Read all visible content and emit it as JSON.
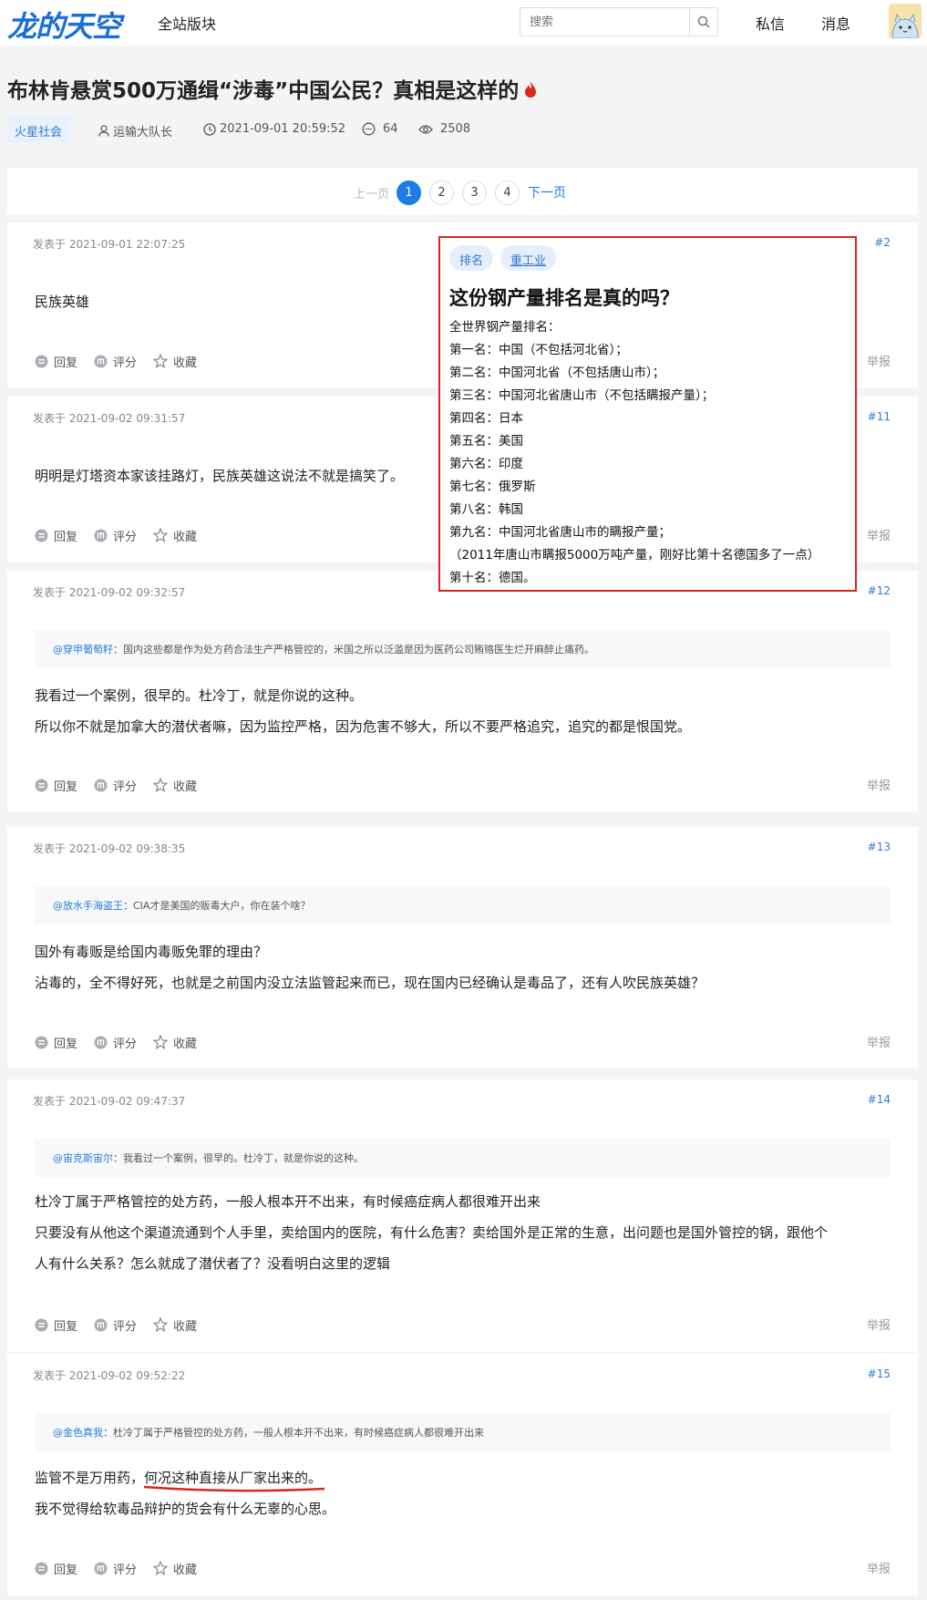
{
  "header": {
    "logo": "龙的天空",
    "nav_all": "全站版块",
    "search_placeholder": "搜索",
    "nav_dm": "私信",
    "nav_msg": "消息"
  },
  "thread": {
    "title": "布林肯悬赏500万通缉“涉毒”中国公民？真相是这样的",
    "category": "火星社会",
    "author": "运输大队长",
    "datetime": "2021-09-01 20:59:52",
    "replies": "64",
    "views": "2508"
  },
  "pager": {
    "prev": "上一页",
    "pages": [
      "1",
      "2",
      "3",
      "4"
    ],
    "current": "1",
    "next": "下一页"
  },
  "action_labels": {
    "reply": "回复",
    "rate": "评分",
    "fav": "收藏",
    "report": "举报"
  },
  "posts": [
    {
      "date": "发表于 2021-09-01 22:07:25",
      "floor": "#2",
      "quote": null,
      "lines": [
        "民族英雄"
      ]
    },
    {
      "date": "发表于 2021-09-02 09:31:57",
      "floor": "#11",
      "quote": null,
      "lines": [
        "明明是灯塔资本家该挂路灯，民族英雄这说法不就是搞笑了。"
      ]
    },
    {
      "date": "发表于 2021-09-02 09:32:57",
      "floor": "#12",
      "quote": {
        "name": "@穿甲葡萄籽",
        "text": "：国内这些都是作为处方药合法生产严格管控的，米国之所以泛滥是因为医药公司贿赂医生烂开麻醉止痛药。"
      },
      "lines": [
        "我看过一个案例，很早的。杜冷丁，就是你说的这种。",
        "所以你不就是加拿大的潜伏者嘛，因为监控严格，因为危害不够大，所以不要严格追究，追究的都是恨国党。"
      ]
    },
    {
      "date": "发表于 2021-09-02 09:38:35",
      "floor": "#13",
      "quote": {
        "name": "@放水手海盗王",
        "text": "：CIA才是美国的贩毒大户，你在装个啥？"
      },
      "lines": [
        "国外有毒贩是给国内毒贩免罪的理由？",
        "沾毒的，全不得好死，也就是之前国内没立法监管起来而已，现在国内已经确认是毒品了，还有人吹民族英雄？"
      ]
    },
    {
      "date": "发表于 2021-09-02 09:47:37",
      "floor": "#14",
      "quote": {
        "name": "@宙克斯宙尔",
        "text": "：我看过一个案例，很早的。杜冷丁，就是你说的这种。"
      },
      "lines": [
        "杜冷丁属于严格管控的处方药，一般人根本开不出来，有时候癌症病人都很难开出来",
        "只要没有从他这个渠道流通到个人手里，卖给国内的医院，有什么危害？卖给国外是正常的生意，出问题也是国外管控的锅，跟他个",
        "人有什么关系？怎么就成了潜伏者了？没看明白这里的逻辑"
      ]
    },
    {
      "date": "发表于 2021-09-02 09:52:22",
      "floor": "#15",
      "quote": {
        "name": "@金色真我",
        "text": "：杜冷丁属于严格管控的处方药，一般人根本开不出来，有时候癌症病人都很难开出来"
      },
      "lines": [
        "监管不是万用药，",
        "我不觉得给软毒品辩护的货会有什么无辜的心思。"
      ],
      "underlined": "何况这种直接从厂家出来的。"
    }
  ],
  "overlay": {
    "tags": [
      "排名",
      "重工业"
    ],
    "title": "这份钢产量排名是真的吗？",
    "lines": [
      "全世界钢产量排名：",
      "第一名：中国（不包括河北省）；",
      "第二名：中国河北省（不包括唐山市）；",
      "第三名：中国河北省唐山市（不包括瞒报产量）；",
      "第四名：日本",
      "第五名：美国",
      "第六名：印度",
      "第七名：俄罗斯",
      "第八名：韩国",
      "第九名：中国河北省唐山市的瞒报产量；",
      "（2011年唐山市瞒报5000万吨产量，刚好比第十名德国多了一点）",
      "第十名：德国。"
    ]
  },
  "colors": {
    "accent": "#1a7ce6",
    "link": "#2d7ad6",
    "overlay_border": "#d9261c",
    "fire": "#e0251b"
  }
}
